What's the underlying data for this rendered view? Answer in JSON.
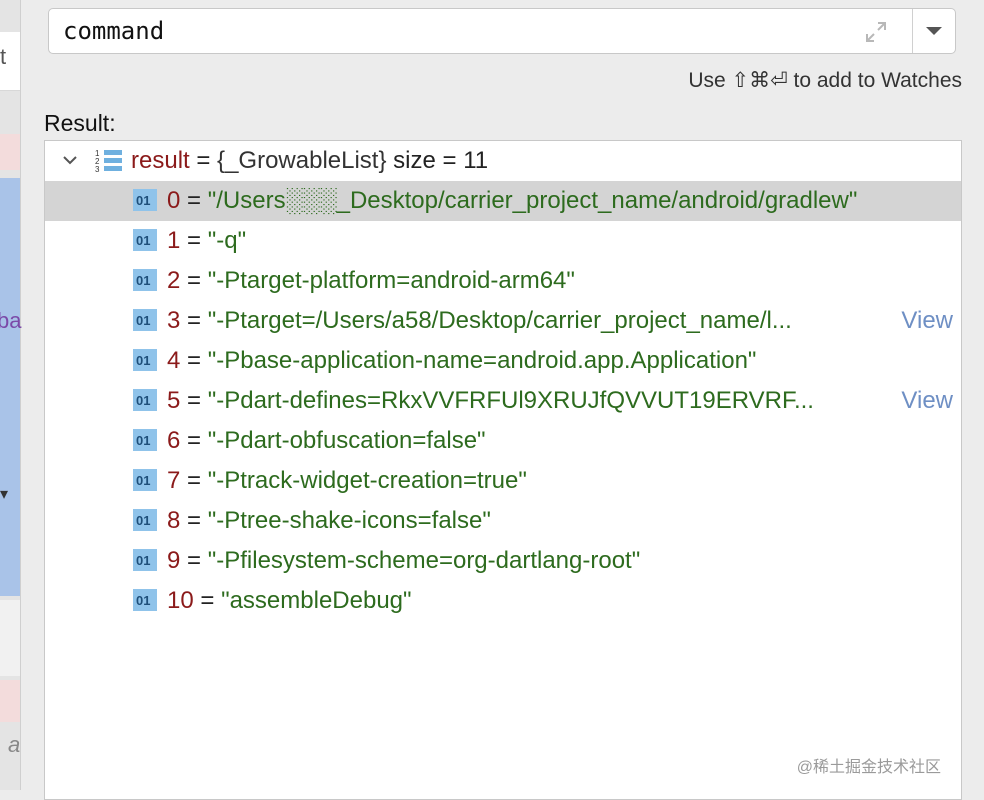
{
  "expression": {
    "value": "command"
  },
  "hint": "Use ⇧⌘⏎ to add to Watches",
  "result_label": "Result:",
  "root": {
    "name": "result",
    "equals": " = ",
    "type": "{_GrowableList}",
    "suffix": " size = 11"
  },
  "items": [
    {
      "index": "0",
      "value": "\"/Users░░░_Desktop/carrier_project_name/android/gradlew\""
    },
    {
      "index": "1",
      "value": "\"-q\""
    },
    {
      "index": "2",
      "value": "\"-Ptarget-platform=android-arm64\""
    },
    {
      "index": "3",
      "value": "\"-Ptarget=/Users/a58/Desktop/carrier_project_name/l",
      "truncated": "...",
      "view": "View"
    },
    {
      "index": "4",
      "value": "\"-Pbase-application-name=android.app.Application\""
    },
    {
      "index": "5",
      "value": "\"-Pdart-defines=RkxVVFRFUl9XRUJfQVVUT19ERVRF",
      "truncated": "...",
      "view": "View"
    },
    {
      "index": "6",
      "value": "\"-Pdart-obfuscation=false\""
    },
    {
      "index": "7",
      "value": "\"-Ptrack-widget-creation=true\""
    },
    {
      "index": "8",
      "value": "\"-Ptree-shake-icons=false\""
    },
    {
      "index": "9",
      "value": "\"-Pfilesystem-scheme=org-dartlang-root\""
    },
    {
      "index": "10",
      "value": "\"assembleDebug\""
    }
  ],
  "item_icon_text": "01",
  "left_strip": {
    "c1": "t",
    "c2": "ba",
    "c3": "▾",
    "c4": "a"
  },
  "watermark": "@稀土掘金技术社区",
  "colors": {
    "var": "#8b1a1a",
    "string": "#2d6b1e",
    "link": "#6e8fc4",
    "selected": "#d4d4d4"
  }
}
